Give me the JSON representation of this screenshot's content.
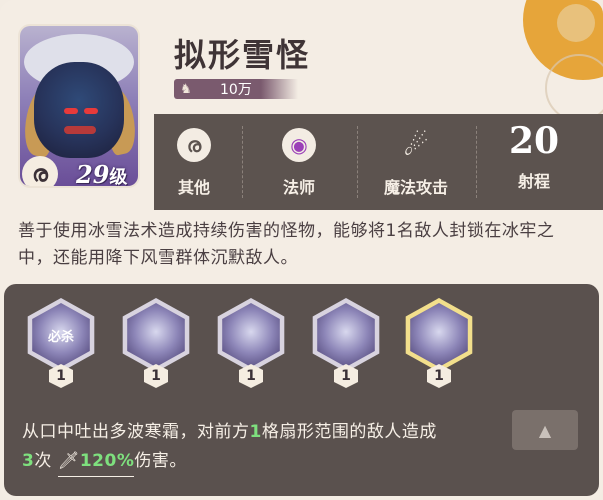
{
  "unit": {
    "name": "拟形雪怪",
    "power_label": "10万",
    "level": "29",
    "level_unit": "级"
  },
  "stats": [
    {
      "icon": "swirl-icon",
      "label": "其他"
    },
    {
      "icon": "mage-icon",
      "label": "法师"
    },
    {
      "icon": "comet-icon",
      "label": "魔法攻击"
    },
    {
      "value": "20",
      "label": "射程"
    }
  ],
  "description": "善于使用冰雪法术造成持续伤害的怪物，能够将1名敌人封锁在冰牢之中，还能用降下风雪群体沉默敌人。",
  "skills": [
    {
      "name": "必杀",
      "level": "1",
      "selected": false
    },
    {
      "name": "",
      "level": "1",
      "selected": false
    },
    {
      "name": "",
      "level": "1",
      "selected": false
    },
    {
      "name": "",
      "level": "1",
      "selected": false
    },
    {
      "name": "",
      "level": "1",
      "selected": true
    }
  ],
  "skill_detail": {
    "line1_a": "从口中吐出多波寒霜，对前方",
    "line1_hl": "1",
    "line1_b": "格扇形范围的敌人造成",
    "hits": "3",
    "hits_unit": "次",
    "percent": "120%",
    "suffix": "伤害。"
  },
  "colors": {
    "panel": "#5a514e",
    "highlight": "#7ee07e",
    "accent_sun": "#e6a53a"
  }
}
